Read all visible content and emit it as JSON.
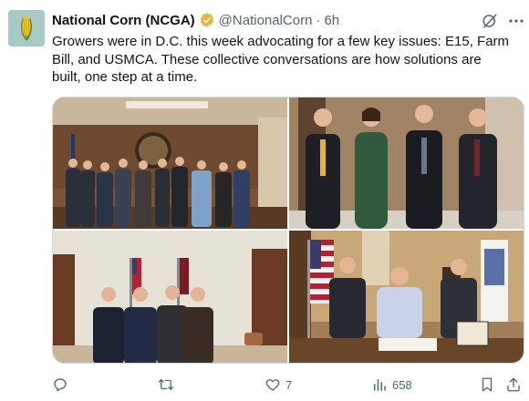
{
  "author": {
    "display_name": "National Corn (NCGA)",
    "handle": "@NationalCorn",
    "separator": "·",
    "time": "6h"
  },
  "post": {
    "text": "Growers were in D.C. this week advocating for a few key issues: E15, Farm Bill, and USMCA. These collective conversations are how solutions are built, one step at a time."
  },
  "media": {
    "photos": [
      {
        "name": "group-photo-conference-room"
      },
      {
        "name": "four-people-hallway"
      },
      {
        "name": "five-people-office"
      },
      {
        "name": "signing-at-desk"
      }
    ]
  },
  "actions": {
    "reply_count": "",
    "retweet_count": "",
    "like_count": "7",
    "views_count": "658"
  },
  "icons": {
    "verified": "verified-gold-badge-icon",
    "grok": "grok-icon",
    "more": "more-icon",
    "reply": "reply-icon",
    "retweet": "retweet-icon",
    "like": "like-icon",
    "views": "views-icon",
    "bookmark": "bookmark-icon",
    "share": "share-icon"
  },
  "colors": {
    "text": "#0f1419",
    "secondary": "#536471",
    "verified_gold": "#e8b339",
    "avatar_bg": "#a9c9c4"
  }
}
